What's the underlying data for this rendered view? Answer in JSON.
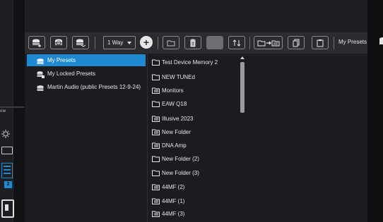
{
  "toolbar": {
    "mode_select": "1 Way",
    "add_symbol": "+",
    "title": "My Presets"
  },
  "sidebar_strip": {
    "label": "ow",
    "badge": "2"
  },
  "tree": {
    "items": [
      {
        "label": "My Presets",
        "icon": "database-icon",
        "selected": true
      },
      {
        "label": "My Locked Presets",
        "icon": "database-lock-icon",
        "selected": false
      },
      {
        "label": "Martin Audio (public Presets 12-9-24)",
        "icon": "database-icon",
        "selected": false
      }
    ]
  },
  "files": [
    {
      "label": "Test Device Memory 2",
      "icon": "folder-icon"
    },
    {
      "label": "NEW TUNEd",
      "icon": "folder-icon"
    },
    {
      "label": "Monitors",
      "icon": "folder-filled-icon"
    },
    {
      "label": "EAW Q18",
      "icon": "folder-icon"
    },
    {
      "label": "Illusive 2023",
      "icon": "folder-filled-icon"
    },
    {
      "label": "New Folder",
      "icon": "folder-filled-icon"
    },
    {
      "label": "DNA Amp",
      "icon": "folder-filled-icon"
    },
    {
      "label": "New Folder (2)",
      "icon": "folder-icon"
    },
    {
      "label": "New Folder (3)",
      "icon": "folder-icon"
    },
    {
      "label": "44MF (2)",
      "icon": "folder-filled-icon"
    },
    {
      "label": "44MF (1)",
      "icon": "folder-filled-icon"
    },
    {
      "label": "44MF (3)",
      "icon": "folder-filled-icon"
    }
  ],
  "colors": {
    "accent": "#1f8ad1",
    "background": "#1b1c1f",
    "toolbar": "#2b2c30"
  }
}
